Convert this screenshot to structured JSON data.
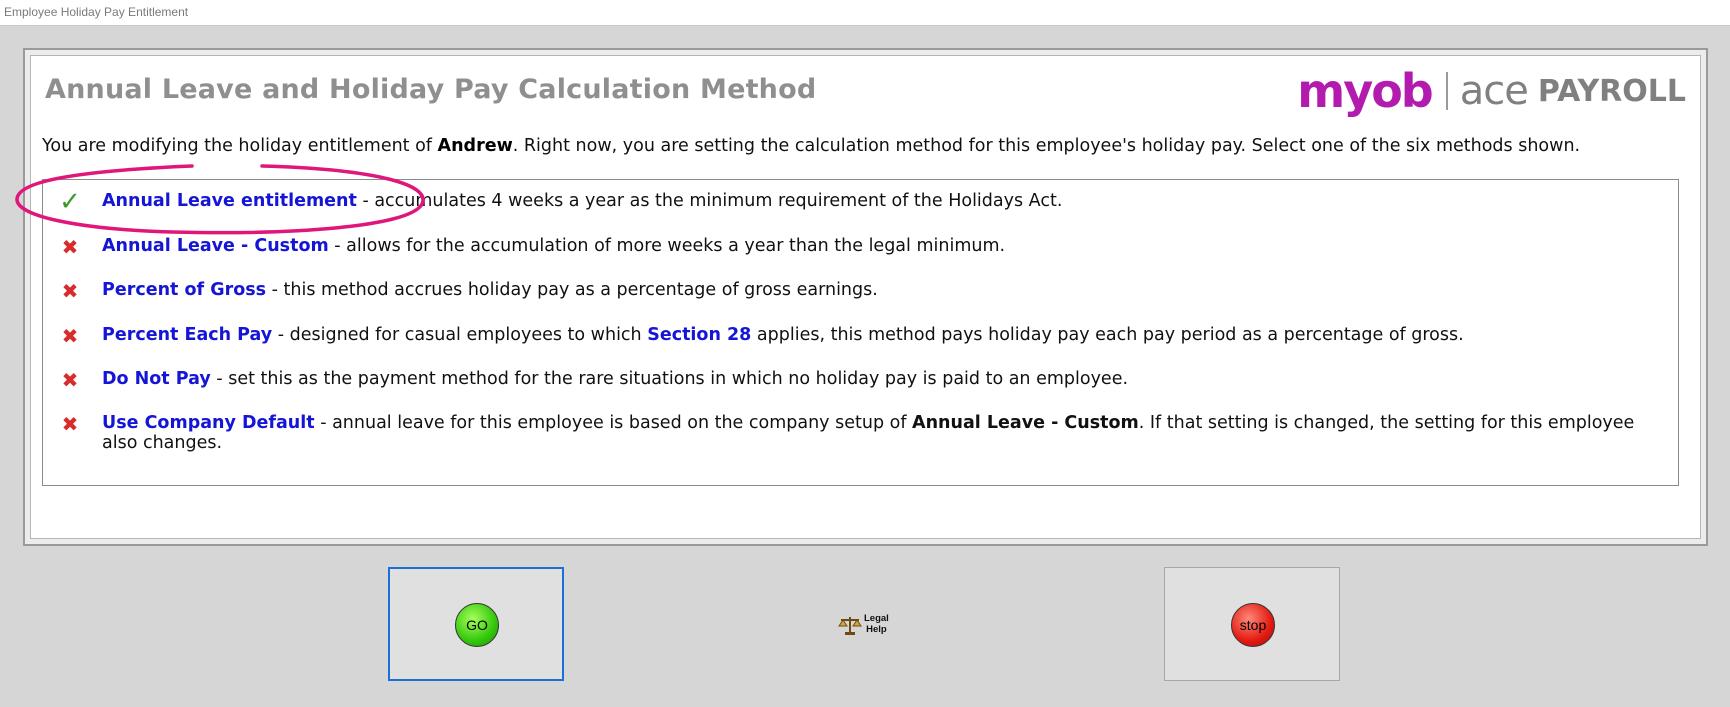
{
  "window": {
    "title": "Employee Holiday Pay Entitlement"
  },
  "header": {
    "heading": "Annual Leave and Holiday Pay Calculation Method",
    "logo": {
      "myob": "myob",
      "ace": "ace",
      "payroll": "PAYROLL"
    }
  },
  "intro": {
    "prefix": "You are modifying the holiday entitlement of ",
    "employee": "Andrew",
    "suffix": ". Right now, you are setting the calculation method for this employee's holiday pay. Select one of the six methods shown."
  },
  "options": [
    {
      "name": "Annual Leave entitlement",
      "desc": " - accumulates 4 weeks a year as the minimum requirement of the Holidays Act.",
      "selected": true,
      "icon": "check-icon"
    },
    {
      "name": "Annual Leave - Custom",
      "desc": " - allows for the accumulation of more weeks a year than the legal minimum.",
      "selected": false,
      "icon": "cross-icon"
    },
    {
      "name": "Percent of Gross",
      "desc": " - this method accrues holiday pay as a percentage of gross earnings.",
      "selected": false,
      "icon": "cross-icon"
    },
    {
      "name": "Percent Each Pay",
      "desc_pre": " - designed for casual employees to which ",
      "link": "Section 28",
      "desc_post": " applies, this method pays holiday pay each pay period as a percentage of gross.",
      "selected": false,
      "icon": "cross-icon"
    },
    {
      "name": "Do Not Pay",
      "desc": " - set this as the payment method for the rare situations in which no holiday pay is paid to an employee.",
      "selected": false,
      "icon": "cross-icon"
    },
    {
      "name": "Use Company Default",
      "desc_pre": " - annual leave for this employee is based on the company setup of ",
      "bold": "Annual Leave - Custom",
      "desc_post": ". If that setting is changed, the setting for this employee also changes.",
      "selected": false,
      "icon": "cross-icon"
    }
  ],
  "buttons": {
    "go": "GO",
    "legal_line1": "Legal",
    "legal_line2": "Help",
    "stop": "stop"
  },
  "colors": {
    "link": "#1515d6",
    "heading": "#8f8f8f",
    "annotation": "#e0177a",
    "go": "#34c70c",
    "stop": "#e31a12"
  }
}
